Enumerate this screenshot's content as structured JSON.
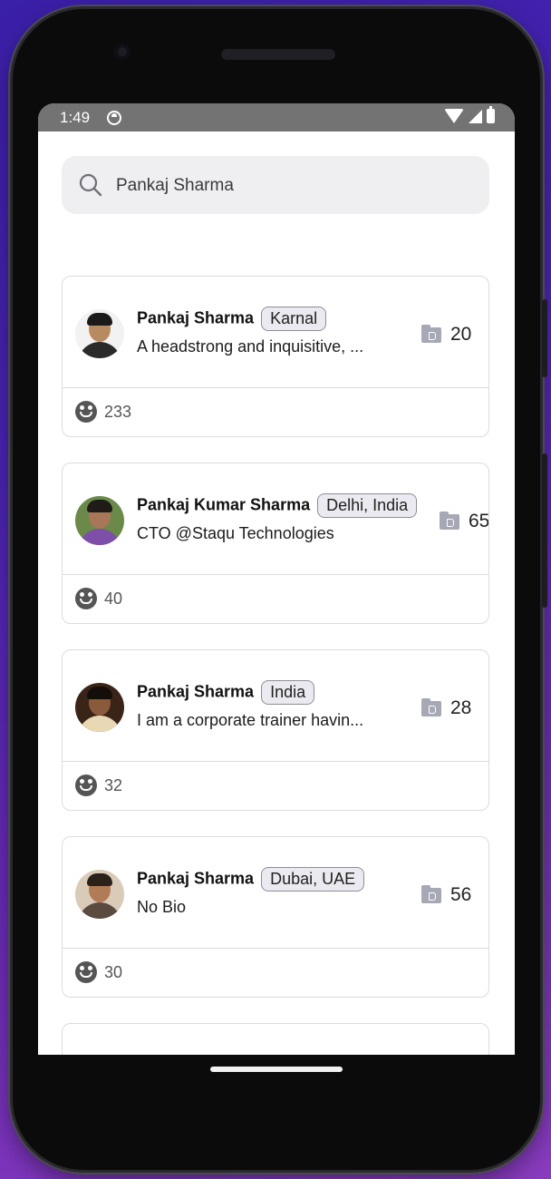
{
  "status_bar": {
    "time": "1:49"
  },
  "search": {
    "value": "Pankaj Sharma",
    "placeholder": "Search"
  },
  "results": [
    {
      "name": "Pankaj Sharma",
      "location": "Karnal",
      "bio": "A headstrong and inquisitive, ...",
      "files": "20",
      "followers": "233"
    },
    {
      "name": "Pankaj Kumar Sharma",
      "location": "Delhi, India",
      "bio": "CTO @Staqu Technologies",
      "files": "65",
      "followers": "40"
    },
    {
      "name": "Pankaj Sharma",
      "location": "India",
      "bio": "I am a corporate trainer havin...",
      "files": "28",
      "followers": "32"
    },
    {
      "name": "Pankaj Sharma",
      "location": "Dubai, UAE",
      "bio": "No Bio",
      "files": "56",
      "followers": "30"
    }
  ]
}
